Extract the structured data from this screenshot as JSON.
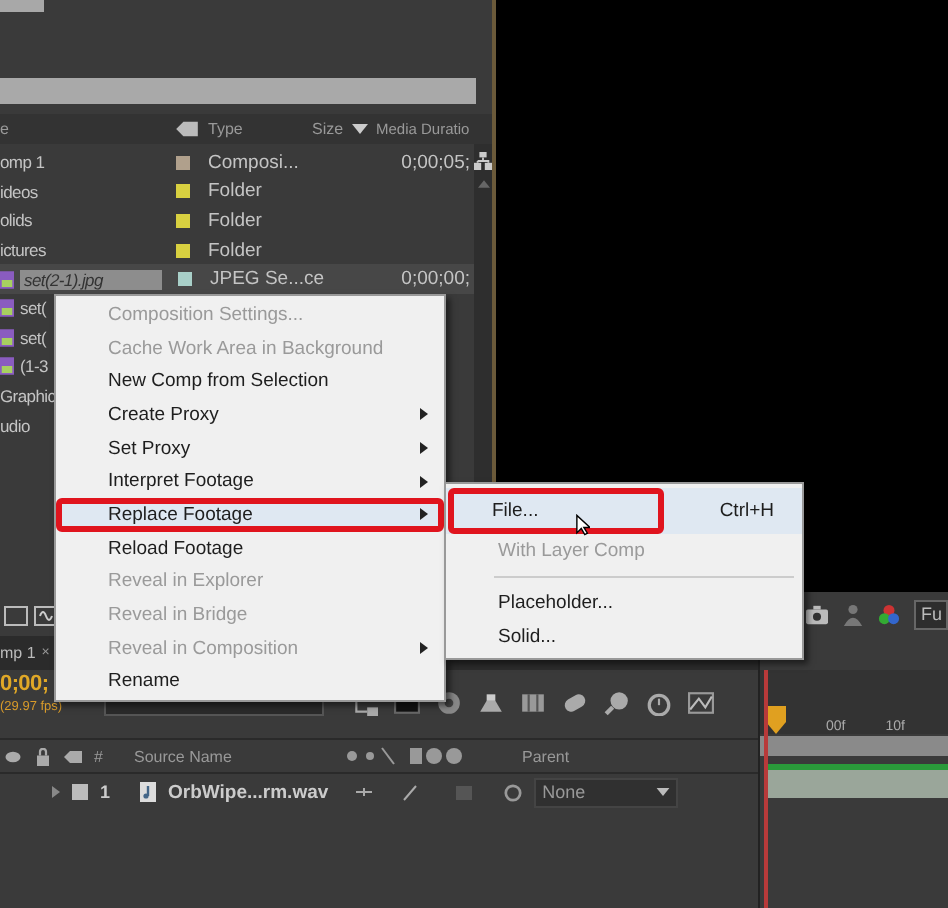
{
  "project": {
    "columns": [
      {
        "kind": "name",
        "label": "e"
      },
      {
        "kind": "tag"
      },
      {
        "kind": "type",
        "label": "Type"
      },
      {
        "kind": "size",
        "label": "Size"
      },
      {
        "kind": "duration",
        "label": "Media Duratio"
      }
    ],
    "rows": [
      {
        "name": "omp 1",
        "kind": "comp",
        "color": "#b0a08c",
        "type": "Composi...",
        "duration": "0;00;05;",
        "selected": false
      },
      {
        "name": "ideos",
        "kind": "folder",
        "color": "#d8d040",
        "type": "Folder",
        "selected": false
      },
      {
        "name": "olids",
        "kind": "folder",
        "color": "#d8d040",
        "type": "Folder",
        "selected": false
      },
      {
        "name": "ictures",
        "kind": "folder",
        "color": "#d8d040",
        "type": "Folder",
        "selected": false
      },
      {
        "name": "set(2-1).jpg",
        "kind": "image",
        "color": "#a8cfc8",
        "type": "JPEG Se...ce",
        "duration": "0;00;00;",
        "selected": true
      },
      {
        "name": "set(",
        "kind": "image",
        "selected": false
      },
      {
        "name": "set(",
        "kind": "image",
        "selected": false
      },
      {
        "name": "(1-3",
        "kind": "image",
        "selected": false
      },
      {
        "name": "Graphic",
        "kind": "folder",
        "selected": false
      },
      {
        "name": "udio",
        "kind": "folder",
        "selected": false
      }
    ]
  },
  "viewer": {
    "button": "Fu"
  },
  "context_menu": {
    "items": [
      {
        "label": "Composition Settings...",
        "disabled": true,
        "submenu": false,
        "selected": false,
        "outlined": false
      },
      {
        "label": "Cache Work Area in Background",
        "disabled": true,
        "submenu": false,
        "selected": false,
        "outlined": false
      },
      {
        "label": "New Comp from Selection",
        "disabled": false,
        "submenu": false,
        "selected": false,
        "outlined": false
      },
      {
        "label": "Create Proxy",
        "disabled": false,
        "submenu": true,
        "selected": false,
        "outlined": false
      },
      {
        "label": "Set Proxy",
        "disabled": false,
        "submenu": true,
        "selected": false,
        "outlined": false
      },
      {
        "label": "Interpret Footage",
        "disabled": false,
        "submenu": true,
        "selected": false,
        "outlined": false
      },
      {
        "label": "Replace Footage",
        "disabled": false,
        "submenu": true,
        "selected": true,
        "outlined": true
      },
      {
        "label": "Reload Footage",
        "disabled": false,
        "submenu": false,
        "selected": false,
        "outlined": false
      },
      {
        "label": "Reveal in Explorer",
        "disabled": true,
        "submenu": false,
        "selected": false,
        "outlined": false
      },
      {
        "label": "Reveal in Bridge",
        "disabled": true,
        "submenu": false,
        "selected": false,
        "outlined": false
      },
      {
        "label": "Reveal in Composition",
        "disabled": true,
        "submenu": true,
        "selected": false,
        "outlined": false
      },
      {
        "label": "Rename",
        "disabled": false,
        "submenu": false,
        "selected": false,
        "outlined": false
      }
    ]
  },
  "submenu": {
    "items": [
      {
        "kind": "item",
        "label": "File...",
        "shortcut": "Ctrl+H",
        "disabled": false,
        "selected": true,
        "outlined": true
      },
      {
        "kind": "item",
        "label": "With Layer Comp",
        "disabled": true,
        "selected": false,
        "outlined": false
      },
      {
        "kind": "separator"
      },
      {
        "kind": "item",
        "label": "Placeholder...",
        "disabled": false,
        "selected": false,
        "outlined": false
      },
      {
        "kind": "item",
        "label": "Solid...",
        "disabled": false,
        "selected": false,
        "outlined": false
      }
    ]
  },
  "timeline": {
    "tab": {
      "label": "mp 1",
      "close": "×"
    },
    "timecode": "0;00;",
    "fps": "(29.97 fps)",
    "columns": [
      {
        "kind": "number",
        "label": "#"
      },
      {
        "kind": "source",
        "label": "Source Name"
      },
      {
        "kind": "parent",
        "label": "Parent"
      }
    ],
    "layers": [
      {
        "number": "1",
        "name": "OrbWipe...rm.wav",
        "parent": "None",
        "kind": "audio"
      }
    ],
    "ruler": [
      "00f",
      "10f"
    ]
  }
}
